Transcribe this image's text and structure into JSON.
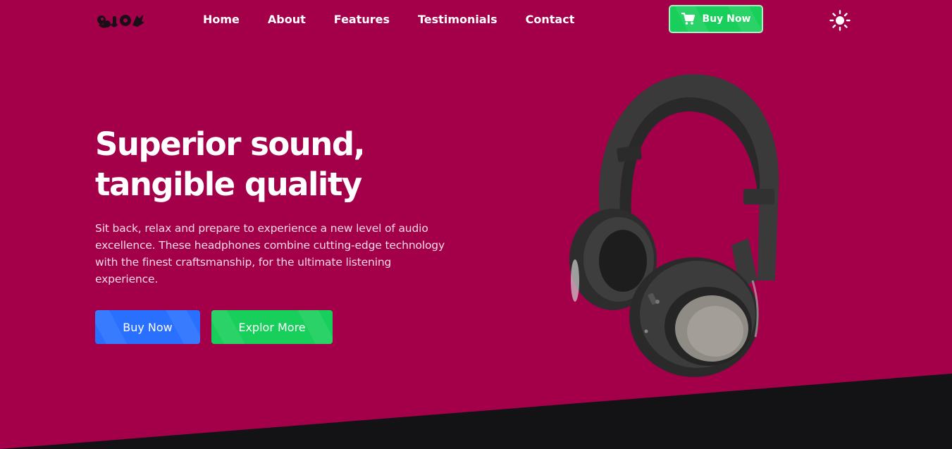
{
  "nav": {
    "links": [
      "Home",
      "About",
      "Features",
      "Testimonials",
      "Contact"
    ],
    "buy_label": "Buy Now",
    "logo_icon": "brand-logo-icon",
    "cart_icon": "cart-icon",
    "theme_icon": "sun-icon"
  },
  "hero": {
    "title_line1": "Superior sound,",
    "title_line2": "tangible quality",
    "description": "Sit back, relax and prepare to experience a new level of audio excellence. These headphones combine cutting-edge technology with the finest craftsmanship, for the ultimate listening experience.",
    "buy_label": "Buy Now",
    "explore_label": "Explor More",
    "image": "headphones-image"
  },
  "colors": {
    "background": "#a4004a",
    "bottom_band": "#131315",
    "primary_blue": "#2970ff",
    "primary_green": "#19cf5c",
    "text": "#ffffff"
  }
}
